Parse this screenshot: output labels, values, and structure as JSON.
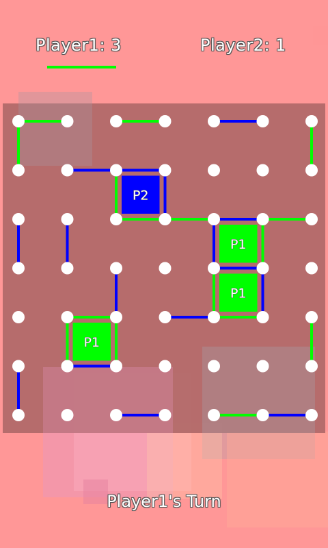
{
  "scoreboard": {
    "player1": "Player1: 3",
    "player2": "Player2: 1",
    "active_player": 1
  },
  "turn_label": "Player1's Turn",
  "colors": {
    "background": "#ff9797",
    "board": "#b06868",
    "player1": "#00ff00",
    "player2": "#0000ff",
    "dot": "#ffffff"
  },
  "board": {
    "rows": 7,
    "cols": 7,
    "edges": [
      {
        "from": [
          0,
          0
        ],
        "to": [
          0,
          1
        ],
        "owner": 1
      },
      {
        "from": [
          0,
          0
        ],
        "to": [
          1,
          0
        ],
        "owner": 1
      },
      {
        "from": [
          0,
          2
        ],
        "to": [
          0,
          3
        ],
        "owner": 1
      },
      {
        "from": [
          0,
          4
        ],
        "to": [
          0,
          5
        ],
        "owner": 2
      },
      {
        "from": [
          0,
          6
        ],
        "to": [
          1,
          6
        ],
        "owner": 1
      },
      {
        "from": [
          1,
          1
        ],
        "to": [
          1,
          2
        ],
        "owner": 2
      },
      {
        "from": [
          1,
          2
        ],
        "to": [
          1,
          3
        ],
        "owner": 2
      },
      {
        "from": [
          1,
          2
        ],
        "to": [
          2,
          2
        ],
        "owner": 1
      },
      {
        "from": [
          1,
          3
        ],
        "to": [
          2,
          3
        ],
        "owner": 2
      },
      {
        "from": [
          2,
          2
        ],
        "to": [
          2,
          3
        ],
        "owner": 1
      },
      {
        "from": [
          2,
          3
        ],
        "to": [
          2,
          4
        ],
        "owner": 1
      },
      {
        "from": [
          2,
          4
        ],
        "to": [
          2,
          5
        ],
        "owner": 2
      },
      {
        "from": [
          2,
          5
        ],
        "to": [
          2,
          6
        ],
        "owner": 1
      },
      {
        "from": [
          2,
          4
        ],
        "to": [
          3,
          4
        ],
        "owner": 2
      },
      {
        "from": [
          2,
          5
        ],
        "to": [
          3,
          5
        ],
        "owner": 1
      },
      {
        "from": [
          2,
          0
        ],
        "to": [
          3,
          0
        ],
        "owner": 2
      },
      {
        "from": [
          2,
          1
        ],
        "to": [
          3,
          1
        ],
        "owner": 2
      },
      {
        "from": [
          3,
          4
        ],
        "to": [
          3,
          5
        ],
        "owner": 2
      },
      {
        "from": [
          3,
          4
        ],
        "to": [
          4,
          4
        ],
        "owner": 1
      },
      {
        "from": [
          3,
          5
        ],
        "to": [
          4,
          5
        ],
        "owner": 2
      },
      {
        "from": [
          3,
          2
        ],
        "to": [
          4,
          2
        ],
        "owner": 2
      },
      {
        "from": [
          4,
          3
        ],
        "to": [
          4,
          4
        ],
        "owner": 2
      },
      {
        "from": [
          4,
          4
        ],
        "to": [
          4,
          5
        ],
        "owner": 1
      },
      {
        "from": [
          4,
          1
        ],
        "to": [
          4,
          2
        ],
        "owner": 1
      },
      {
        "from": [
          4,
          1
        ],
        "to": [
          5,
          1
        ],
        "owner": 1
      },
      {
        "from": [
          4,
          2
        ],
        "to": [
          5,
          2
        ],
        "owner": 1
      },
      {
        "from": [
          5,
          1
        ],
        "to": [
          5,
          2
        ],
        "owner": 2
      },
      {
        "from": [
          4,
          6
        ],
        "to": [
          5,
          6
        ],
        "owner": 1
      },
      {
        "from": [
          5,
          0
        ],
        "to": [
          6,
          0
        ],
        "owner": 2
      },
      {
        "from": [
          6,
          2
        ],
        "to": [
          6,
          3
        ],
        "owner": 2
      },
      {
        "from": [
          6,
          4
        ],
        "to": [
          6,
          5
        ],
        "owner": 1
      },
      {
        "from": [
          6,
          5
        ],
        "to": [
          6,
          6
        ],
        "owner": 2
      }
    ],
    "boxes": [
      {
        "row": 1,
        "col": 2,
        "owner": 2,
        "label": "P2"
      },
      {
        "row": 2,
        "col": 4,
        "owner": 1,
        "label": "P1"
      },
      {
        "row": 3,
        "col": 4,
        "owner": 1,
        "label": "P1"
      },
      {
        "row": 4,
        "col": 1,
        "owner": 1,
        "label": "P1"
      }
    ]
  }
}
